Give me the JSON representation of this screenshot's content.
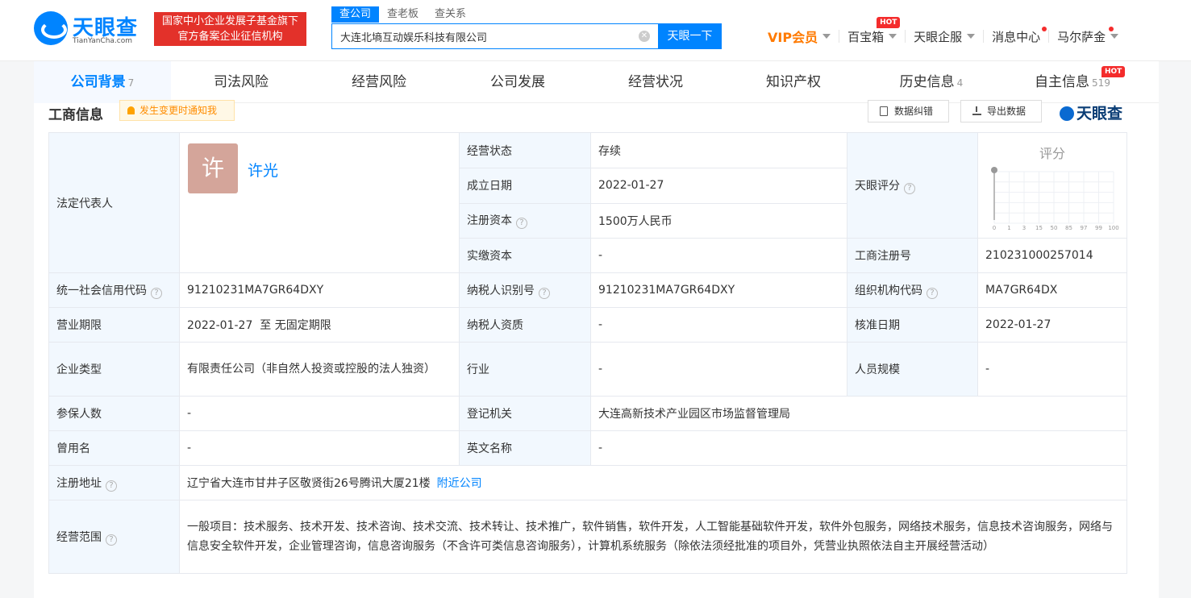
{
  "header": {
    "logo_text": "天眼查",
    "logo_sub": "TianYanCha.com",
    "slogan_line1": "国家中小企业发展子基金旗下",
    "slogan_line2": "官方备案企业征信机构",
    "search_tabs": [
      "查公司",
      "查老板",
      "查关系"
    ],
    "search_value": "大连北墒互动娱乐科技有限公司",
    "search_button": "天眼一下",
    "nav": {
      "vip": "VIP会员",
      "baibaoxiang": "百宝箱",
      "hot": "HOT",
      "qifu": "天眼企服",
      "messages": "消息中心",
      "user": "马尔萨金"
    }
  },
  "tabs": [
    {
      "label": "公司背景",
      "count": "7"
    },
    {
      "label": "司法风险",
      "count": ""
    },
    {
      "label": "经营风险",
      "count": ""
    },
    {
      "label": "公司发展",
      "count": ""
    },
    {
      "label": "经营状况",
      "count": ""
    },
    {
      "label": "知识产权",
      "count": ""
    },
    {
      "label": "历史信息",
      "count": "4"
    },
    {
      "label": "自主信息",
      "count": "519",
      "badge": "HOT"
    }
  ],
  "section": {
    "title": "工商信息",
    "notify": "发生变更时通知我",
    "correct": "数据纠错",
    "export": "导出数据",
    "watermark": "天眼查"
  },
  "info": {
    "legal_rep_label": "法定代表人",
    "avatar_char": "许",
    "legal_rep": "许光",
    "status_label": "经营状态",
    "status": "存续",
    "found_label": "成立日期",
    "found": "2022-01-27",
    "reg_capital_label": "注册资本",
    "reg_capital": "1500万人民币",
    "paid_capital_label": "实缴资本",
    "paid_capital": "-",
    "score_label": "天眼评分",
    "score_title": "评分",
    "score_ticks": [
      "0",
      "1",
      "3",
      "15",
      "50",
      "85",
      "97",
      "99",
      "100"
    ],
    "reg_no_label": "工商注册号",
    "reg_no": "210231000257014",
    "credit_code_label": "统一社会信用代码",
    "credit_code": "91210231MA7GR64DXY",
    "taxpayer_id_label": "纳税人识别号",
    "taxpayer_id": "91210231MA7GR64DXY",
    "org_code_label": "组织机构代码",
    "org_code": "MA7GR64DX",
    "term_label": "营业期限",
    "term": "2022-01-27  至 无固定期限",
    "taxpayer_qual_label": "纳税人资质",
    "taxpayer_qual": "-",
    "approve_label": "核准日期",
    "approve": "2022-01-27",
    "type_label": "企业类型",
    "type": "有限责任公司（非自然人投资或控股的法人独资）",
    "industry_label": "行业",
    "industry": "-",
    "staff_label": "人员规模",
    "staff": "-",
    "insured_label": "参保人数",
    "insured": "-",
    "authority_label": "登记机关",
    "authority": "大连高新技术产业园区市场监督管理局",
    "former_label": "曾用名",
    "former": "-",
    "english_label": "英文名称",
    "english": "-",
    "address_label": "注册地址",
    "address": "辽宁省大连市甘井子区敬贤街26号腾讯大厦21楼",
    "nearby": "附近公司",
    "scope_label": "经营范围",
    "scope": "一般项目：技术服务、技术开发、技术咨询、技术交流、技术转让、技术推广，软件销售，软件开发，人工智能基础软件开发，软件外包服务，网络技术服务，信息技术咨询服务，网络与信息安全软件开发，企业管理咨询，信息咨询服务（不含许可类信息咨询服务），计算机系统服务（除依法须经批准的项目外，凭营业执照依法自主开展经营活动）"
  }
}
